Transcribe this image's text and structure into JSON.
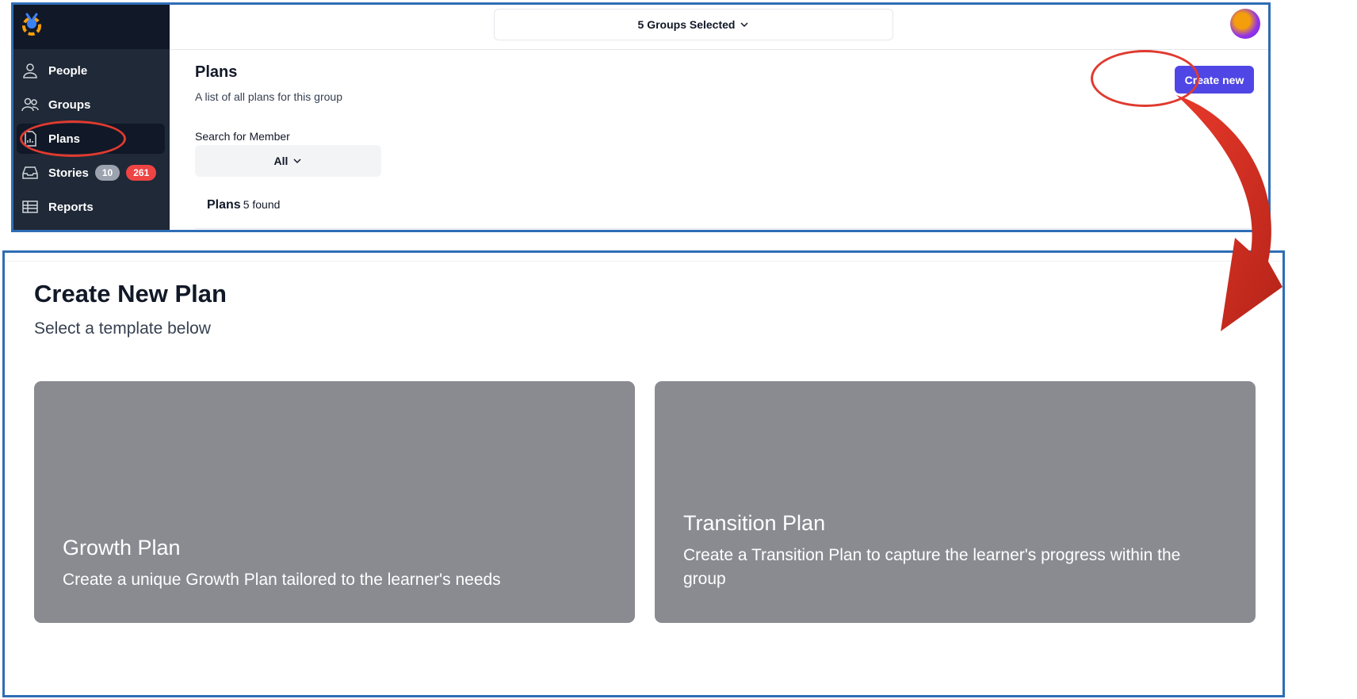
{
  "top": {
    "group_selector": "5 Groups Selected",
    "sidebar": {
      "items": [
        {
          "label": "People",
          "icon": "person-icon"
        },
        {
          "label": "Groups",
          "icon": "groups-icon"
        },
        {
          "label": "Plans",
          "icon": "plans-icon"
        },
        {
          "label": "Stories",
          "icon": "stories-icon",
          "badges": [
            "10",
            "261"
          ]
        },
        {
          "label": "Reports",
          "icon": "reports-icon"
        }
      ],
      "active": "Plans"
    },
    "main": {
      "title": "Plans",
      "subtitle": "A list of all plans for this group",
      "create_button": "Create new",
      "search_label": "Search for Member",
      "member_select": "All",
      "plans_count_label": "Plans",
      "plans_count_found": "5 found"
    }
  },
  "bottom": {
    "title": "Create New Plan",
    "subtitle": "Select a template below",
    "cards": [
      {
        "title": "Growth Plan",
        "description": "Create a unique Growth Plan tailored to the learner's needs"
      },
      {
        "title": "Transition Plan",
        "description": "Create a Transition Plan to capture the learner's progress within the group"
      }
    ]
  },
  "colors": {
    "annotation_red": "#e03a2f",
    "frame_blue": "#2f6db5",
    "primary_button": "#4f46e5",
    "card_gray": "#898b91",
    "sidebar_bg": "#1f2937"
  }
}
